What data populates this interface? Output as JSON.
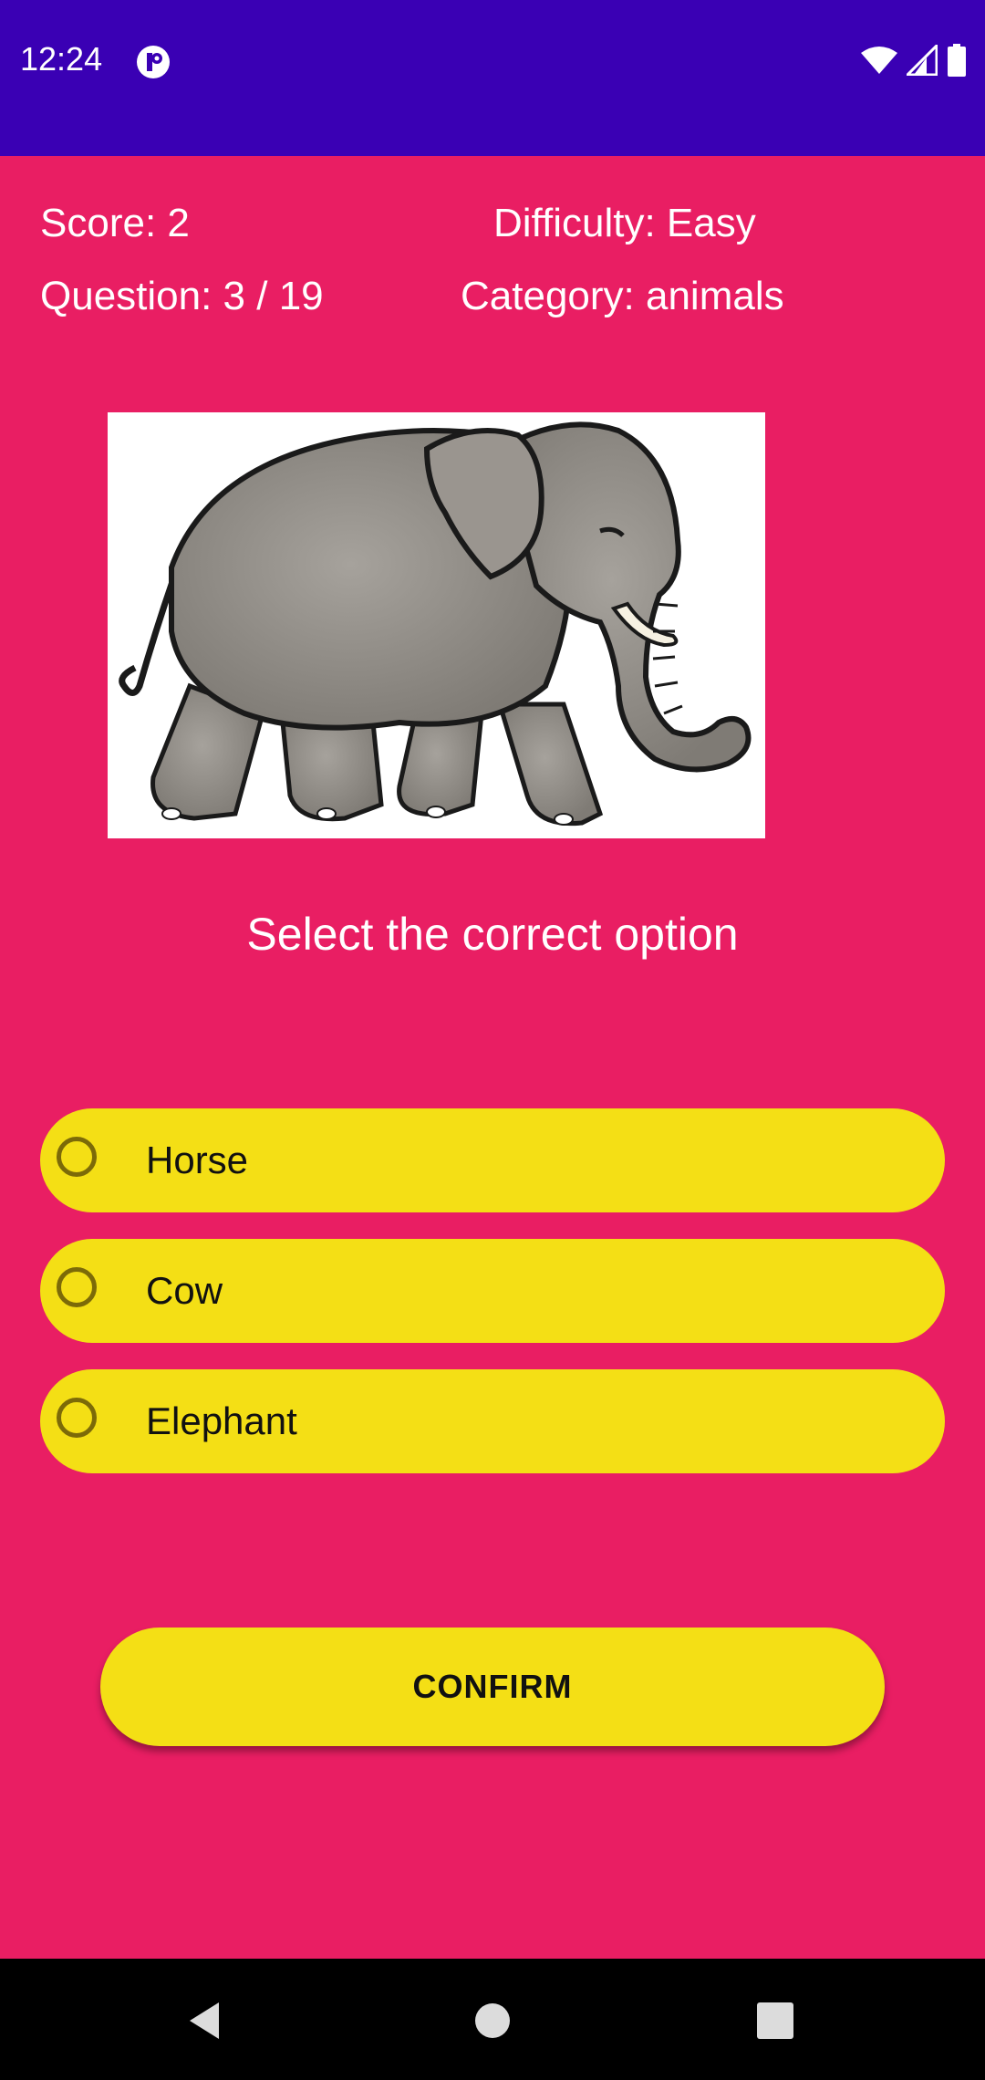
{
  "status_bar": {
    "time": "12:24",
    "background": "#3A00B4",
    "icons": [
      "app-notification-icon",
      "wifi-icon",
      "cell-signal-icon",
      "battery-icon"
    ]
  },
  "quiz": {
    "score_label": "Score: 2",
    "difficulty_label": "Difficulty: Easy",
    "question_label": "Question: 3 / 19",
    "category_label": "Category: animals",
    "image": "elephant-illustration",
    "prompt": "Select the correct option",
    "options": [
      {
        "label": "Horse",
        "selected": false
      },
      {
        "label": "Cow",
        "selected": false
      },
      {
        "label": "Elephant",
        "selected": false
      }
    ],
    "confirm_label": "CONFIRM"
  },
  "colors": {
    "background": "#E91E63",
    "option_fill": "#F4DF15",
    "radio_border": "#7C6A08",
    "text": "#FFFFFF"
  },
  "nav_bar": {
    "buttons": [
      "back-icon",
      "home-icon",
      "recents-icon"
    ]
  }
}
